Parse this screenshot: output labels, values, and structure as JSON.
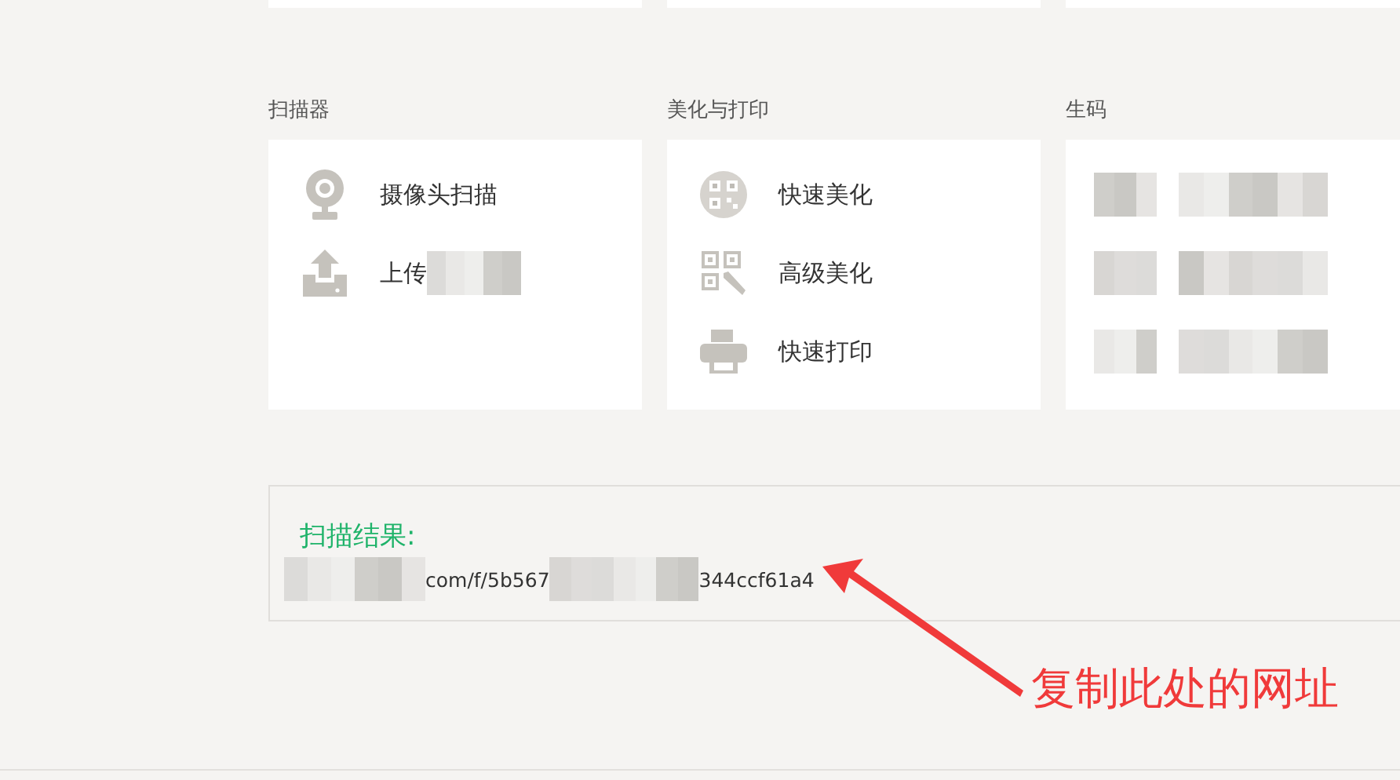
{
  "sections": [
    {
      "title": "扫描器",
      "items": [
        {
          "kind": "entry",
          "label": "摄像头扫描",
          "masked": false
        },
        {
          "kind": "entry",
          "label": "上传",
          "masked": true
        }
      ]
    },
    {
      "title": "美化与打印",
      "items": [
        {
          "kind": "entry",
          "label": "快速美化",
          "masked": false
        },
        {
          "kind": "entry",
          "label": "高级美化",
          "masked": false
        },
        {
          "kind": "entry",
          "label": "快速打印",
          "masked": false
        }
      ]
    },
    {
      "title": "生码",
      "items": [
        {
          "kind": "mosaic"
        },
        {
          "kind": "mosaic"
        },
        {
          "kind": "mosaic"
        }
      ]
    }
  ],
  "result": {
    "label": "扫描结果:",
    "url_parts": [
      "com/f/5b567",
      "344ccf61a4"
    ]
  },
  "annotation": {
    "text": "复制此处的网址"
  }
}
